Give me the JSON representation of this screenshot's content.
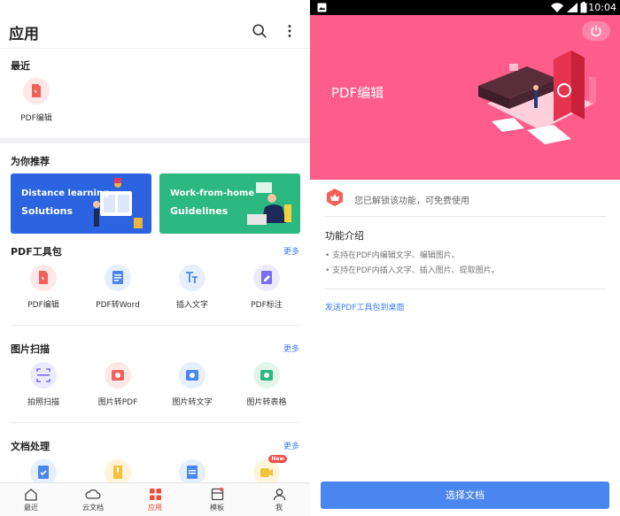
{
  "left": {
    "header": {
      "title": "应用"
    },
    "recent": {
      "title": "最近",
      "item_label": "PDF编辑"
    },
    "recommend": {
      "title": "为你推荐",
      "card1": {
        "line1": "Distance learning",
        "line2": "Solutions",
        "color": "#2b63e0"
      },
      "card2": {
        "line1": "Work-from-home",
        "line2": "Guidelines",
        "color": "#2cb981"
      }
    },
    "pdf_tools": {
      "title": "PDF工具包",
      "more": "更多",
      "items": [
        {
          "label": "PDF编辑"
        },
        {
          "label": "PDF转Word"
        },
        {
          "label": "插入文字"
        },
        {
          "label": "PDF标注"
        }
      ]
    },
    "image_scan": {
      "title": "图片扫描",
      "more": "更多",
      "items": [
        {
          "label": "拍照扫描"
        },
        {
          "label": "图片转PDF"
        },
        {
          "label": "图片转文字"
        },
        {
          "label": "图片转表格"
        }
      ]
    },
    "doc_process": {
      "title": "文档处理",
      "more": "更多",
      "badge": "New"
    },
    "tabs": [
      {
        "label": "最近"
      },
      {
        "label": "云文档"
      },
      {
        "label": "应用"
      },
      {
        "label": "模板"
      },
      {
        "label": "我"
      }
    ],
    "accent": "#f04b3a"
  },
  "right": {
    "status": {
      "time": "10:04"
    },
    "hero": {
      "title": "PDF编辑",
      "color": "#fe5c8b"
    },
    "unlock": "您已解锁该功能，可免费使用",
    "intro": {
      "title": "功能介绍",
      "items": [
        "支持在PDF内编辑文字、编辑图片。",
        "支持在PDF内插入文字、插入图片、提取图片。"
      ]
    },
    "send_link": "发送PDF工具包到桌面",
    "choose_button": "选择文档"
  }
}
